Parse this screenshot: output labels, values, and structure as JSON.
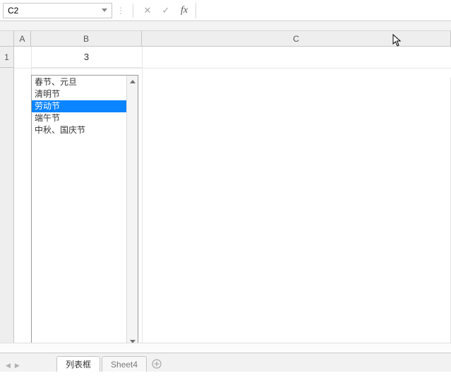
{
  "formula_bar": {
    "name_box_value": "C2",
    "cancel_icon": "✕",
    "enter_icon": "✓",
    "fx_label": "fx",
    "formula_value": ""
  },
  "columns": {
    "A": "A",
    "B": "B",
    "C": "C"
  },
  "rows": {
    "r1": "1"
  },
  "cells": {
    "B1": "3"
  },
  "listbox": {
    "items": [
      {
        "label": "春节、元旦",
        "selected": false
      },
      {
        "label": "清明节",
        "selected": false
      },
      {
        "label": "劳动节",
        "selected": true
      },
      {
        "label": "端午节",
        "selected": false
      },
      {
        "label": "中秋、国庆节",
        "selected": false
      }
    ]
  },
  "tabs": {
    "items": [
      {
        "label": "列表框",
        "active": true
      },
      {
        "label": "Sheet4",
        "active": false
      }
    ]
  }
}
